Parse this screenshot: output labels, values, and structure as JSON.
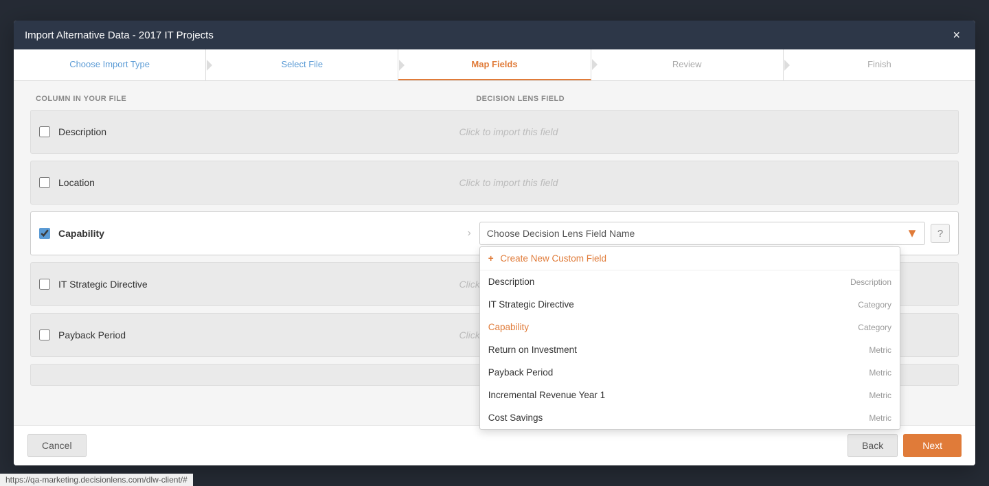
{
  "modal": {
    "title": "Import Alternative Data - 2017 IT Projects",
    "close_label": "×"
  },
  "stepper": {
    "steps": [
      {
        "id": "choose-import-type",
        "label": "Choose Import Type",
        "state": "done"
      },
      {
        "id": "select-file",
        "label": "Select File",
        "state": "done"
      },
      {
        "id": "map-fields",
        "label": "Map Fields",
        "state": "active"
      },
      {
        "id": "review",
        "label": "Review",
        "state": "inactive"
      },
      {
        "id": "finish",
        "label": "Finish",
        "state": "inactive"
      }
    ]
  },
  "columns": {
    "left_header": "COLUMN IN YOUR FILE",
    "right_header": "DECISION LENS FIELD"
  },
  "fields": [
    {
      "id": "description",
      "name": "Description",
      "checked": false,
      "mapping_placeholder": "Click to import this field",
      "has_arrow": false
    },
    {
      "id": "location",
      "name": "Location",
      "checked": false,
      "mapping_placeholder": "Click to import this field",
      "has_arrow": false
    },
    {
      "id": "capability",
      "name": "Capability",
      "checked": true,
      "mapping_placeholder": "Choose Decision Lens Field Name",
      "has_arrow": true,
      "active": true
    },
    {
      "id": "it-strategic-directive",
      "name": "IT Strategic Directive",
      "checked": false,
      "mapping_placeholder": "Click to import this field",
      "has_arrow": false
    },
    {
      "id": "payback-period",
      "name": "Payback Period",
      "checked": false,
      "mapping_placeholder": "Click to import this field",
      "has_arrow": false
    }
  ],
  "dropdown": {
    "placeholder": "Choose Decision Lens Field Name",
    "create_new_label": "Create New Custom Field",
    "items": [
      {
        "label": "Description",
        "type": "Description",
        "highlighted": false
      },
      {
        "label": "IT Strategic Directive",
        "type": "Category",
        "highlighted": false
      },
      {
        "label": "Capability",
        "type": "Category",
        "highlighted": true
      },
      {
        "label": "Return on Investment",
        "type": "Metric",
        "highlighted": false
      },
      {
        "label": "Payback Period",
        "type": "Metric",
        "highlighted": false
      },
      {
        "label": "Incremental Revenue Year 1",
        "type": "Metric",
        "highlighted": false
      },
      {
        "label": "Cost Savings",
        "type": "Metric",
        "highlighted": false
      }
    ]
  },
  "footer": {
    "cancel_label": "Cancel",
    "back_label": "Back",
    "next_label": "Next"
  },
  "status_bar": {
    "url": "https://qa-marketing.decisionlens.com/dlw-client/#"
  }
}
